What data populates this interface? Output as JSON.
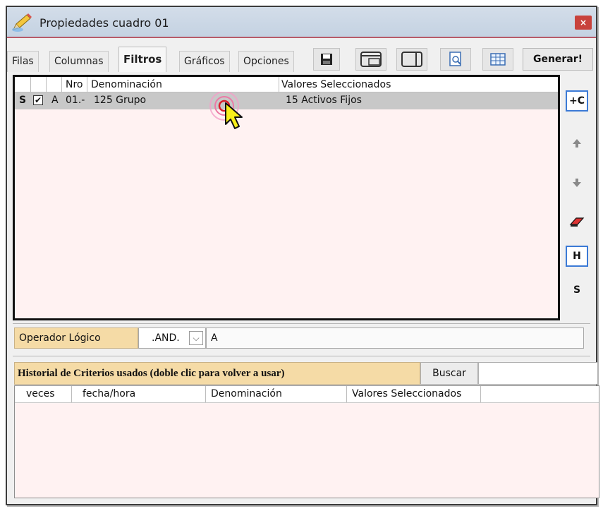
{
  "window": {
    "title": "Propiedades cuadro 01",
    "close_glyph": "×"
  },
  "tabs": [
    {
      "label": "Filas",
      "active": false
    },
    {
      "label": "Columnas",
      "active": false
    },
    {
      "label": "Filtros",
      "active": true
    },
    {
      "label": "Gráficos",
      "active": false
    },
    {
      "label": "Opciones",
      "active": false
    }
  ],
  "toolbar": {
    "icons": [
      "save-icon",
      "window-layout-icon",
      "panel-split-icon",
      "print-preview-icon",
      "grid-table-icon"
    ],
    "generate_label": "Generar!"
  },
  "filter_grid": {
    "columns": [
      "",
      "",
      "",
      "Nro",
      "Denominación",
      "Valores Seleccionados"
    ],
    "rows": [
      {
        "s": "S",
        "checked": true,
        "checkmark": "✔",
        "a": "A",
        "nro": "01.-",
        "denominacion": "125  Grupo",
        "valores": "15 Activos Fijos"
      }
    ]
  },
  "side_buttons": {
    "add_column": "+C",
    "up": "up-arrow-icon",
    "down": "down-arrow-icon",
    "eraser": "eraser-icon",
    "h": "H",
    "s": "S"
  },
  "operator": {
    "label": "Operador Lógico",
    "value": ".AND.",
    "dropdown_glyph": "⌵",
    "text": "A"
  },
  "history": {
    "title": "Historial de Criterios usados  (doble clic para volver a usar)",
    "search_label": "Buscar",
    "search_value": "",
    "columns": [
      "veces",
      "fecha/hora",
      "Denominación",
      "Valores Seleccionados"
    ]
  },
  "colors": {
    "accent_border": "#3b7ad6",
    "label_bg": "#f5dba6",
    "grid_bg": "#fff2f2",
    "selected_row": "#c8c8c8"
  }
}
